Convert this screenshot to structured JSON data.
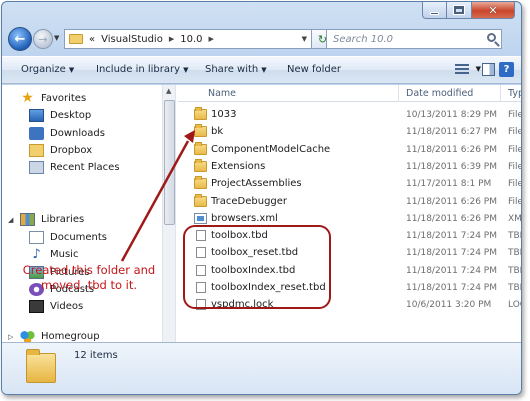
{
  "window": {
    "caption": {
      "close_glyph": "✕"
    }
  },
  "address_bar": {
    "segments": [
      "«",
      "VisualStudio",
      "10.0"
    ],
    "search_placeholder": "Search 10.0"
  },
  "toolbar": {
    "organize": "Organize",
    "include_in_library": "Include in library",
    "share_with": "Share with",
    "new_folder": "New folder"
  },
  "nav_pane": {
    "favorites_label": "Favorites",
    "favorites": [
      "Desktop",
      "Downloads",
      "Dropbox",
      "Recent Places"
    ],
    "libraries_label": "Libraries",
    "libraries": [
      "Documents",
      "Music",
      "Pictures",
      "Podcasts",
      "Videos"
    ],
    "homegroup_label": "Homegroup"
  },
  "file_list": {
    "columns": {
      "name": "Name",
      "date": "Date modified",
      "type": "Type"
    },
    "rows": [
      {
        "name": "1033",
        "date": "10/13/2011 8:29 PM",
        "type": "File",
        "icon": "folder-icon"
      },
      {
        "name": "bk",
        "date": "11/18/2011 6:27 PM",
        "type": "File",
        "icon": "folder-icon"
      },
      {
        "name": "ComponentModelCache",
        "date": "11/18/2011 6:26 PM",
        "type": "File",
        "icon": "folder-icon"
      },
      {
        "name": "Extensions",
        "date": "11/18/2011 6:39 PM",
        "type": "File",
        "icon": "folder-icon"
      },
      {
        "name": "ProjectAssemblies",
        "date": "11/17/2011 8:1 PM",
        "type": "File",
        "icon": "folder-icon"
      },
      {
        "name": "TraceDebugger",
        "date": "11/18/2011 6:26 PM",
        "type": "File",
        "icon": "folder-icon"
      },
      {
        "name": "browsers.xml",
        "date": "11/18/2011 6:26 PM",
        "type": "XM",
        "icon": "xml-file-icon"
      },
      {
        "name": "toolbox.tbd",
        "date": "11/18/2011 7:24 PM",
        "type": "TBD",
        "icon": "file-icon"
      },
      {
        "name": "toolbox_reset.tbd",
        "date": "11/18/2011 7:24 PM",
        "type": "TBD",
        "icon": "file-icon"
      },
      {
        "name": "toolboxIndex.tbd",
        "date": "11/18/2011 7:24 PM",
        "type": "TBD",
        "icon": "file-icon"
      },
      {
        "name": "toolboxIndex_reset.tbd",
        "date": "11/18/2011 7:24 PM",
        "type": "TBD",
        "icon": "file-icon"
      },
      {
        "name": "vspdmc.lock",
        "date": "10/6/2011 3:20 PM",
        "type": "LOC",
        "icon": "file-icon"
      }
    ]
  },
  "annotation": {
    "text": "Created this folder and moved .tbd to it.",
    "color": "#c5161a"
  },
  "details": {
    "item_count": "12 items"
  }
}
